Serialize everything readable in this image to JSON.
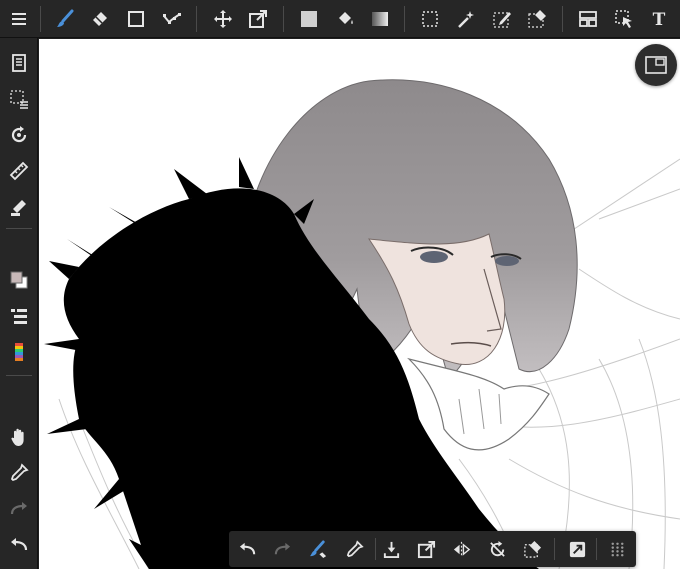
{
  "app": {
    "accent_color": "#4a90d9",
    "icon_color": "#e6e6e6",
    "toolbar_bg": "#262626",
    "canvas_bg": "#ffffff"
  },
  "top_toolbar": {
    "tools": [
      {
        "id": "menu",
        "icon": "hamburger-menu-icon"
      },
      {
        "id": "brush",
        "icon": "brush-icon",
        "active": true
      },
      {
        "id": "eraser",
        "icon": "eraser-icon"
      },
      {
        "id": "shape",
        "icon": "square-shape-icon"
      },
      {
        "id": "curve",
        "icon": "curve-ruler-icon"
      },
      {
        "id": "move",
        "icon": "move-arrows-icon"
      },
      {
        "id": "transform",
        "icon": "transform-icon"
      },
      {
        "id": "fill-color",
        "icon": "fill-rectangle-icon"
      },
      {
        "id": "bucket",
        "icon": "paint-bucket-icon"
      },
      {
        "id": "gradient",
        "icon": "gradient-icon"
      },
      {
        "id": "select-rect",
        "icon": "rectangle-select-icon"
      },
      {
        "id": "magic-wand",
        "icon": "magic-wand-icon"
      },
      {
        "id": "select-pen",
        "icon": "select-pen-icon"
      },
      {
        "id": "select-eraser",
        "icon": "select-eraser-icon"
      },
      {
        "id": "panel-layout",
        "icon": "panel-layout-icon"
      },
      {
        "id": "select-layer",
        "icon": "select-layer-cursor-icon"
      },
      {
        "id": "text",
        "icon": "text-tool-icon",
        "label": "T"
      }
    ]
  },
  "left_toolbar": {
    "tools": [
      {
        "id": "pages",
        "icon": "pages-icon"
      },
      {
        "id": "selection-menu",
        "icon": "selection-menu-icon"
      },
      {
        "id": "rotate",
        "icon": "rotate-canvas-icon"
      },
      {
        "id": "ruler",
        "icon": "ruler-icon"
      },
      {
        "id": "filter",
        "icon": "filter-pen-icon"
      },
      {
        "id": "color",
        "icon": "color-swatch-icon"
      },
      {
        "id": "layers",
        "icon": "layers-icon"
      },
      {
        "id": "materials",
        "icon": "materials-icon"
      },
      {
        "id": "hand",
        "icon": "hand-icon"
      },
      {
        "id": "eyedropper",
        "icon": "eyedropper-icon"
      },
      {
        "id": "redo",
        "icon": "redo-icon"
      },
      {
        "id": "undo",
        "icon": "undo-icon"
      }
    ],
    "color_swatch": {
      "primary": "#c8b9b9",
      "secondary": "#ffffff"
    }
  },
  "bottom_toolbar": {
    "tools": [
      {
        "id": "undo",
        "icon": "undo-icon"
      },
      {
        "id": "redo",
        "icon": "redo-icon"
      },
      {
        "id": "brush-eraser",
        "icon": "brush-eraser-icon"
      },
      {
        "id": "eyedropper",
        "icon": "eyedropper-icon"
      },
      {
        "id": "import",
        "icon": "import-icon"
      },
      {
        "id": "transform",
        "icon": "transform-icon"
      },
      {
        "id": "flip",
        "icon": "flip-horizontal-icon"
      },
      {
        "id": "reset-rotation",
        "icon": "reset-rotation-icon"
      },
      {
        "id": "clear",
        "icon": "clear-layer-icon"
      },
      {
        "id": "snap",
        "icon": "snap-icon"
      },
      {
        "id": "more",
        "icon": "grid-dots-icon"
      }
    ]
  },
  "canvas": {
    "frame_button_icon": "frame-view-icon"
  }
}
